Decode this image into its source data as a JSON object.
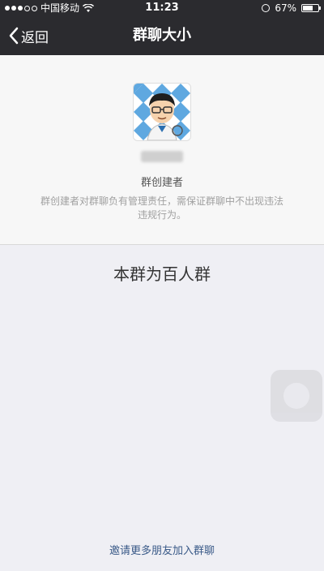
{
  "status_bar": {
    "carrier": "中国移动",
    "time": "11:23",
    "battery": "67%",
    "battery_level": 0.67,
    "signal_filled": 3,
    "signal_total": 5,
    "icons": [
      "signal-icon",
      "wifi-icon",
      "rotation-lock-icon",
      "battery-icon"
    ]
  },
  "nav": {
    "back_label": "返回",
    "title": "群聊大小",
    "back_icon": "chevron-left-icon"
  },
  "creator": {
    "role_label": "群创建者",
    "description": "群创建者对群聊负有管理责任，需保证群聊中不出现违法违规行为。"
  },
  "group": {
    "size_text": "本群为百人群"
  },
  "invite": {
    "link_label": "邀请更多朋友加入群聊"
  },
  "colors": {
    "nav_bg": "#2b2b2f",
    "page_bg": "#efeff4",
    "card_bg": "#f7f7f7",
    "link": "#3a5a88"
  }
}
